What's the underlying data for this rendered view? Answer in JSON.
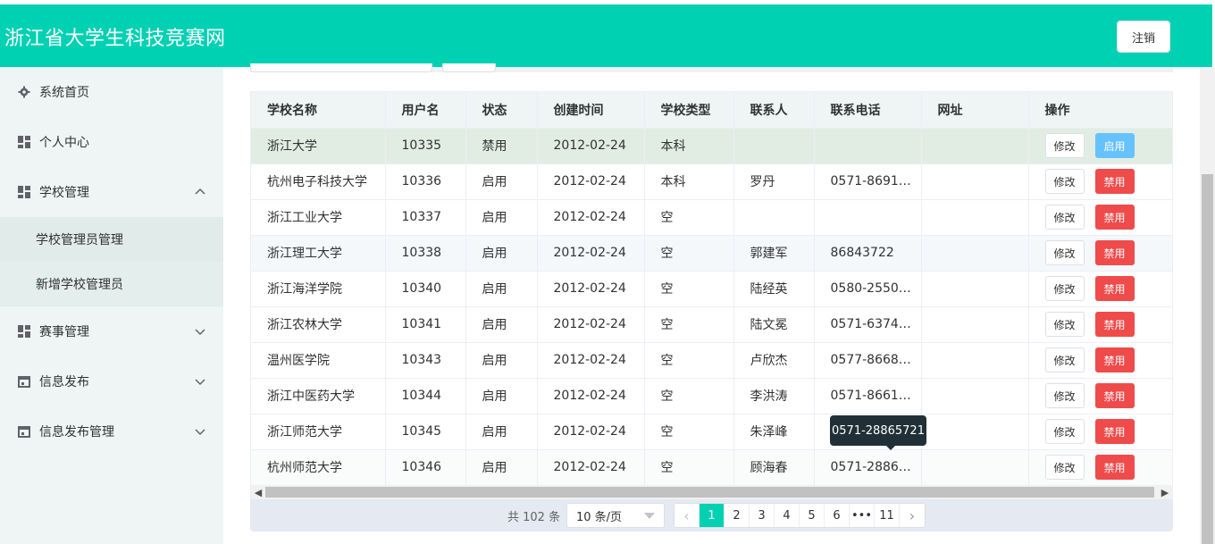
{
  "header": {
    "title": "浙江省大学生科技竞赛网",
    "logout_label": "注销"
  },
  "colors": {
    "brand": "#00d1b2",
    "enable_button": "#66c2ff",
    "disable_button": "#f04b4b",
    "tooltip_bg": "#203036"
  },
  "sidebar": {
    "items": [
      {
        "label": "系统首页",
        "icon": "gear-icon",
        "expandable": false
      },
      {
        "label": "个人中心",
        "icon": "grid-icon",
        "expandable": false
      },
      {
        "label": "学校管理",
        "icon": "grid-icon",
        "expandable": true,
        "expanded": true
      },
      {
        "label": "赛事管理",
        "icon": "grid-icon",
        "expandable": true,
        "expanded": false
      },
      {
        "label": "信息发布",
        "icon": "calendar-icon",
        "expandable": true,
        "expanded": false
      },
      {
        "label": "信息发布管理",
        "icon": "calendar-icon",
        "expandable": true,
        "expanded": false
      }
    ],
    "school_submenu": [
      {
        "label": "学校管理员管理",
        "active": true
      },
      {
        "label": "新增学校管理员",
        "active": false
      }
    ]
  },
  "table": {
    "columns": [
      "学校名称",
      "用户名",
      "状态",
      "创建时间",
      "学校类型",
      "联系人",
      "联系电话",
      "网址",
      "操作"
    ],
    "rows": [
      {
        "name": "浙江大学",
        "username": "10335",
        "status": "禁用",
        "created": "2012-02-24",
        "type": "本科",
        "contact": "",
        "phone": "",
        "url": "",
        "edit": "修改",
        "toggle": "启用"
      },
      {
        "name": "杭州电子科技大学",
        "username": "10336",
        "status": "启用",
        "created": "2012-02-24",
        "type": "本科",
        "contact": "罗丹",
        "phone": "0571-8691…",
        "url": "",
        "edit": "修改",
        "toggle": "禁用"
      },
      {
        "name": "浙江工业大学",
        "username": "10337",
        "status": "启用",
        "created": "2012-02-24",
        "type": "空",
        "contact": "",
        "phone": "",
        "url": "",
        "edit": "修改",
        "toggle": "禁用"
      },
      {
        "name": "浙江理工大学",
        "username": "10338",
        "status": "启用",
        "created": "2012-02-24",
        "type": "空",
        "contact": "郭建军",
        "phone": "86843722",
        "url": "",
        "edit": "修改",
        "toggle": "禁用"
      },
      {
        "name": "浙江海洋学院",
        "username": "10340",
        "status": "启用",
        "created": "2012-02-24",
        "type": "空",
        "contact": "陆经英",
        "phone": "0580-2550…",
        "url": "",
        "edit": "修改",
        "toggle": "禁用"
      },
      {
        "name": "浙江农林大学",
        "username": "10341",
        "status": "启用",
        "created": "2012-02-24",
        "type": "空",
        "contact": "陆文冕",
        "phone": "0571-6374…",
        "url": "",
        "edit": "修改",
        "toggle": "禁用"
      },
      {
        "name": "温州医学院",
        "username": "10343",
        "status": "启用",
        "created": "2012-02-24",
        "type": "空",
        "contact": "卢欣杰",
        "phone": "0577-8668…",
        "url": "",
        "edit": "修改",
        "toggle": "禁用"
      },
      {
        "name": "浙江中医药大学",
        "username": "10344",
        "status": "启用",
        "created": "2012-02-24",
        "type": "空",
        "contact": "李洪涛",
        "phone": "0571-8661…",
        "url": "",
        "edit": "修改",
        "toggle": "禁用"
      },
      {
        "name": "浙江师范大学",
        "username": "10345",
        "status": "启用",
        "created": "2012-02-24",
        "type": "空",
        "contact": "朱泽峰",
        "phone": "",
        "url": "",
        "edit": "修改",
        "toggle": "禁用"
      },
      {
        "name": "杭州师范大学",
        "username": "10346",
        "status": "启用",
        "created": "2012-02-24",
        "type": "空",
        "contact": "顾海春",
        "phone": "0571-2886…",
        "url": "",
        "edit": "修改",
        "toggle": "禁用"
      }
    ]
  },
  "tooltip": {
    "text": "0571-28865721"
  },
  "pagination": {
    "total_label": "共 102 条",
    "page_size": "10 条/页",
    "pages": [
      "1",
      "2",
      "3",
      "4",
      "5",
      "6",
      "•••",
      "11"
    ],
    "current": "1"
  }
}
